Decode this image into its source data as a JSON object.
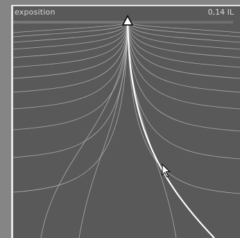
{
  "slider": {
    "label": "exposition",
    "value_text": "0,14 IL",
    "position_fraction": 0.52
  },
  "colors": {
    "background": "#595959",
    "curve": "#c8c8c8",
    "selected_curve": "#ffffff",
    "frame": "#e6e6e6",
    "outer": "#858585"
  },
  "icons": {
    "slider_handle": "triangle-marker-icon",
    "pointer": "mouse-cursor-icon"
  }
}
